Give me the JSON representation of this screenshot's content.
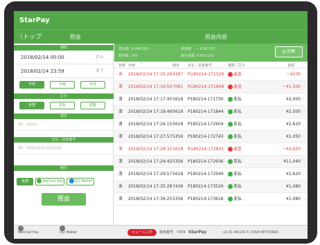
{
  "app": {
    "title": "StarPay"
  },
  "nav": {
    "back_label": "〈トップ",
    "left_title": "照会",
    "right_title": "照会内容"
  },
  "filters": {
    "period_header": "期間",
    "from_date": "2018/02/14 00:00",
    "from_suffix": "から",
    "to_date": "2018/02/14 23:59",
    "to_suffix": "まで",
    "period_buttons": [
      "今日",
      "今週",
      "今月"
    ],
    "status_header": "区分",
    "status_buttons": [
      "全部",
      "支払",
      "返金"
    ],
    "terminal_header": "端末",
    "terminal_placeholder": "例：0000",
    "payment_no_header": "支払／返金番号",
    "payment_no_placeholder": "例：P000000-000000",
    "method_header": "種別",
    "method_buttons": [
      "全部",
      "WeChat Pay",
      "QQ Wallet"
    ],
    "search_label": "照会"
  },
  "summary": {
    "pay_amount_label": "支払額",
    "pay_amount": "￥344,295",
    "pay_count_label": "総件数",
    "pay_count": "145",
    "refund_amount_label": "返金額",
    "refund_amount": "－￥38,762",
    "net_amount_label": "差引金額",
    "net_amount": "￥305,533",
    "print_label": "印刷"
  },
  "table": {
    "headers": [
      "状態",
      "日時",
      "端末",
      "支払／返金番号",
      "種類／区分",
      "金額"
    ],
    "rows": [
      {
        "status": "未",
        "datetime": "2018/02/14 17:15:29",
        "terminal": "4397",
        "number": "R180214-171529",
        "type": "返金",
        "amount": "－¥100",
        "neg": true
      },
      {
        "status": "済",
        "datetime": "2018/02/14 17:16:50",
        "terminal": "7061",
        "number": "R180214-171649",
        "type": "返金",
        "amount": "－¥1,500",
        "neg": true
      },
      {
        "status": "済",
        "datetime": "2018/02/14 17:17:45",
        "terminal": "5618",
        "number": "P180214-171730",
        "type": "支払",
        "amount": "¥2,000",
        "neg": false
      },
      {
        "status": "済",
        "datetime": "2018/02/14 17:18:49",
        "terminal": "5618",
        "number": "P180214-171844",
        "type": "支払",
        "amount": "¥2,500",
        "neg": false
      },
      {
        "status": "済",
        "datetime": "2018/02/14 17:26:15",
        "terminal": "5618",
        "number": "P180214-172604",
        "type": "支払",
        "amount": "¥2,620",
        "neg": false
      },
      {
        "status": "済",
        "datetime": "2018/02/14 17:27:57",
        "terminal": "5356",
        "number": "P180214-172743",
        "type": "支払",
        "amount": "¥1,050",
        "neg": false
      },
      {
        "status": "済",
        "datetime": "2018/02/14 17:28:32",
        "terminal": "5618",
        "number": "R180214-172831",
        "type": "返金",
        "amount": "－¥2,620",
        "neg": true
      },
      {
        "status": "済",
        "datetime": "2018/02/14 17:29:42",
        "terminal": "5356",
        "number": "P180214-172936",
        "type": "支払",
        "amount": "¥11,040",
        "neg": false
      },
      {
        "status": "済",
        "datetime": "2018/02/14 17:29:57",
        "terminal": "5618",
        "number": "P180214-172949",
        "type": "支払",
        "amount": "¥2,620",
        "neg": false
      },
      {
        "status": "未",
        "datetime": "2018/02/14 17:35:28",
        "terminal": "7439",
        "number": "P180214-173529",
        "type": "支払",
        "amount": "¥1,080",
        "neg": false
      },
      {
        "status": "済",
        "datetime": "2018/02/14 17:36:25",
        "terminal": "5356",
        "number": "P180214-173616",
        "type": "支払",
        "amount": "¥1,080",
        "neg": false
      }
    ]
  },
  "footer": {
    "wechat_label": "WeChat Pay",
    "qq_label": "QQ Wallet",
    "training_label": "トレーニング",
    "terminal_no": "端末番号：7439",
    "brand": "StarPay",
    "version": "v3.31  APLUS  © 2018 NETSTARS"
  },
  "colors": {
    "brand_green": "#55a84a",
    "refund_red": "#e23b3b",
    "pay_green": "#3cb043"
  }
}
